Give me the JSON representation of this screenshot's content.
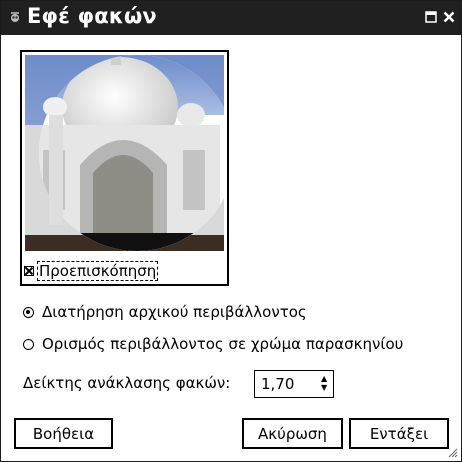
{
  "window": {
    "title": "Εφέ φακών",
    "app_icon": "gimp-icon",
    "controls": [
      "maximize-icon",
      "close-icon"
    ]
  },
  "preview": {
    "checkbox_label": "Προεπισκόπηση",
    "checked": true
  },
  "options": {
    "radio_keep": "Διατήρηση αρχικού περιβάλλοντος",
    "radio_bg": "Ορισμός περιβάλλοντος σε χρώμα παρασκηνίου",
    "selected": "radio_keep"
  },
  "index": {
    "label": "Δείκτης ανάκλασης φακών:",
    "value": "1,70"
  },
  "buttons": {
    "help": "Βοήθεια",
    "cancel": "Ακύρωση",
    "ok": "Εντάξει"
  }
}
